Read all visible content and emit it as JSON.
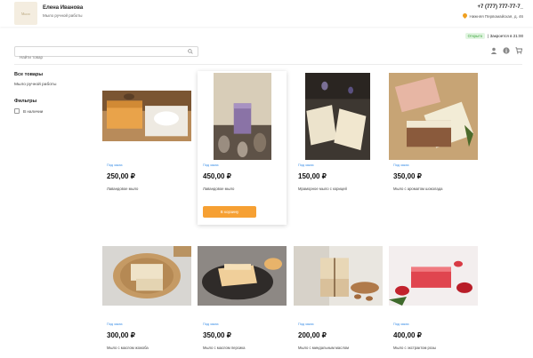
{
  "header": {
    "logo_text": "Мыло",
    "shop_name": "Елена Иванова",
    "shop_sub": "Мыло ручной работы",
    "phone": "+7 (777) 777-77-7_",
    "address": "Нижняя Первомайская, д. 46"
  },
  "status": {
    "badge": "Открыто",
    "text": "| Закроется в 21:00"
  },
  "search": {
    "placeholder": "Найти товар"
  },
  "sidebar": {
    "title": "Все товары",
    "item": "Мыло ручной работы",
    "filters_title": "Фильтры",
    "in_stock": "В наличии"
  },
  "products": [
    {
      "category": "Под заказ",
      "price": "250,00 ₽",
      "name": "Лавандовое мыло"
    },
    {
      "category": "Под заказ",
      "price": "450,00 ₽",
      "name": "Лавандовое мыло",
      "button": "В корзину"
    },
    {
      "category": "Под заказ",
      "price": "150,00 ₽",
      "name": "Мраморное мыло с корицей"
    },
    {
      "category": "Под заказ",
      "price": "350,00 ₽",
      "name": "Мыло с ароматом шоколада"
    },
    {
      "category": "Под заказ",
      "price": "300,00 ₽",
      "name": "Мыло с маслом жожоба"
    },
    {
      "category": "Под заказ",
      "price": "350,00 ₽",
      "name": "Мыло с маслом персика"
    },
    {
      "category": "Под заказ",
      "price": "200,00 ₽",
      "name": "Мыло с миндальным маслом"
    },
    {
      "category": "Под заказ",
      "price": "400,00 ₽",
      "name": "Мыло с экстрактом розы"
    }
  ],
  "colors": {
    "accent": "#f6a033",
    "link": "#3a8ee6",
    "open": "#3ba53b"
  },
  "icons": [
    "search-icon",
    "user-icon",
    "info-icon",
    "cart-icon",
    "location-pin-icon"
  ]
}
